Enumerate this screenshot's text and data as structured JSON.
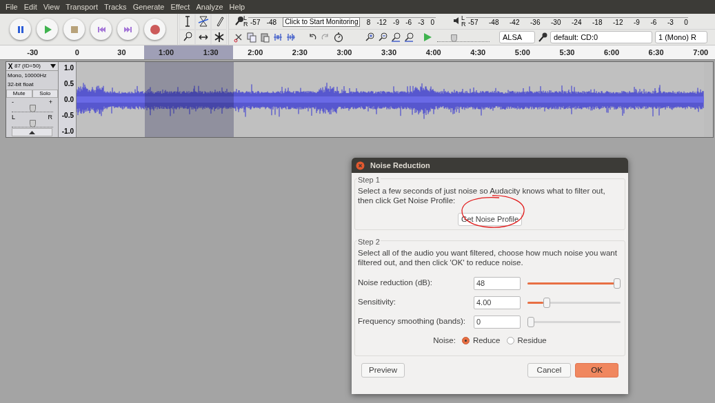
{
  "menu": [
    "File",
    "Edit",
    "View",
    "Transport",
    "Tracks",
    "Generate",
    "Effect",
    "Analyze",
    "Help"
  ],
  "transport": [
    {
      "kind": "pause"
    },
    {
      "kind": "play"
    },
    {
      "kind": "stop"
    },
    {
      "kind": "skip_start"
    },
    {
      "kind": "skip_end"
    },
    {
      "kind": "record"
    }
  ],
  "recording_meter": {
    "channels": [
      "L",
      "R"
    ],
    "labels_before": [
      "-57",
      "-48"
    ],
    "monitor_button": "Click to Start Monitoring",
    "labels_after": [
      "8",
      "-12",
      "-9",
      "-6",
      "-3",
      "0"
    ]
  },
  "playback_meter": {
    "channels": [
      "L",
      "R"
    ],
    "labels": [
      "-57",
      "-48",
      "-42",
      "-36",
      "-30",
      "-24",
      "-18",
      "-12",
      "-9",
      "-6",
      "-3",
      "0"
    ]
  },
  "play_at_speed": {
    "level": 0.3
  },
  "device": {
    "host": "ALSA",
    "input": "default: CD:0",
    "channels": "1 (Mono) R"
  },
  "ruler": [
    {
      "label": "-30",
      "selected": false
    },
    {
      "label": "0",
      "selected": false
    },
    {
      "label": "30",
      "selected": false
    },
    {
      "label": "1:00",
      "selected": true
    },
    {
      "label": "1:30",
      "selected": true
    },
    {
      "label": "2:00",
      "selected": false
    },
    {
      "label": "2:30",
      "selected": false
    },
    {
      "label": "3:00",
      "selected": false
    },
    {
      "label": "3:30",
      "selected": false
    },
    {
      "label": "4:00",
      "selected": false
    },
    {
      "label": "4:30",
      "selected": false
    },
    {
      "label": "5:00",
      "selected": false
    },
    {
      "label": "5:30",
      "selected": false
    },
    {
      "label": "6:00",
      "selected": false
    },
    {
      "label": "6:30",
      "selected": false
    },
    {
      "label": "7:00",
      "selected": false
    }
  ],
  "track": {
    "close": "X",
    "name": "87 (ID=50)",
    "info": [
      "Mono, 10000Hz",
      "32-bit float"
    ],
    "buttons": [
      "Mute",
      "Solo"
    ],
    "gain": {
      "min_label": "-",
      "max_label": "+",
      "level": 0.5
    },
    "pan": {
      "min_label": "L",
      "max_label": "R",
      "level": 0.5
    },
    "vruler": [
      "1.0",
      "0.5",
      "0.0",
      "-0.5",
      "-1.0"
    ]
  },
  "dialog": {
    "title": "Noise Reduction",
    "step1": {
      "legend": "Step 1",
      "text": "Select a few seconds of just noise so Audacity knows what to filter out, then click Get Noise Profile:",
      "button": "Get Noise Profile"
    },
    "step2": {
      "legend": "Step 2",
      "text": "Select all of the audio you want filtered, choose how much noise you want filtered out, and then click 'OK' to reduce noise.",
      "rows": [
        {
          "label": "Noise reduction (dB):",
          "value": "48",
          "level": 1
        },
        {
          "label": "Sensitivity:",
          "value": "4.00",
          "level": 0.18
        },
        {
          "label": "Frequency smoothing (bands):",
          "value": "0",
          "level": 0
        }
      ],
      "noise": {
        "label": "Noise:",
        "options": [
          {
            "label": "Reduce",
            "selected": true
          },
          {
            "label": "Residue",
            "selected": false
          }
        ]
      }
    },
    "buttons": [
      {
        "label": "Preview",
        "kind": "normal"
      },
      {
        "label": "Cancel",
        "kind": "normal"
      },
      {
        "label": "OK",
        "kind": "primary"
      }
    ]
  }
}
